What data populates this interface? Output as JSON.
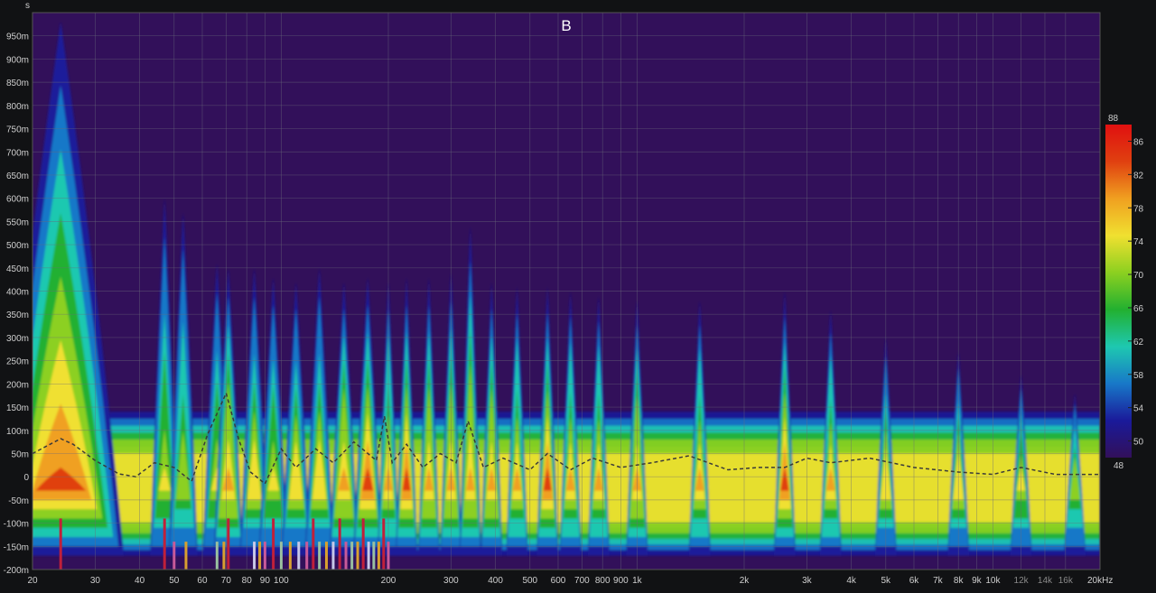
{
  "chart_data": {
    "type": "heatmap",
    "title": "B",
    "y_unit_label": "s",
    "x_scale": "log",
    "xlim_hz": [
      20,
      20000
    ],
    "ylim_s": [
      -0.2,
      1.0
    ],
    "x_ticks": [
      {
        "hz": 20,
        "label": "20"
      },
      {
        "hz": 30,
        "label": "30"
      },
      {
        "hz": 40,
        "label": "40"
      },
      {
        "hz": 50,
        "label": "50"
      },
      {
        "hz": 60,
        "label": "60"
      },
      {
        "hz": 70,
        "label": "70"
      },
      {
        "hz": 80,
        "label": "80"
      },
      {
        "hz": 90,
        "label": "90"
      },
      {
        "hz": 100,
        "label": "100"
      },
      {
        "hz": 200,
        "label": "200"
      },
      {
        "hz": 300,
        "label": "300"
      },
      {
        "hz": 400,
        "label": "400"
      },
      {
        "hz": 500,
        "label": "500"
      },
      {
        "hz": 600,
        "label": "600"
      },
      {
        "hz": 700,
        "label": "700"
      },
      {
        "hz": 800,
        "label": "800"
      },
      {
        "hz": 900,
        "label": "900"
      },
      {
        "hz": 1000,
        "label": "1k"
      },
      {
        "hz": 2000,
        "label": "2k"
      },
      {
        "hz": 3000,
        "label": "3k"
      },
      {
        "hz": 4000,
        "label": "4k"
      },
      {
        "hz": 5000,
        "label": "5k"
      },
      {
        "hz": 6000,
        "label": "6k"
      },
      {
        "hz": 7000,
        "label": "7k"
      },
      {
        "hz": 8000,
        "label": "8k"
      },
      {
        "hz": 9000,
        "label": "9k"
      },
      {
        "hz": 10000,
        "label": "10k"
      },
      {
        "hz": 12000,
        "label": "12k",
        "dim": true
      },
      {
        "hz": 14000,
        "label": "14k",
        "dim": true
      },
      {
        "hz": 16000,
        "label": "16k",
        "dim": true
      },
      {
        "hz": 20000,
        "label": "20kHz"
      }
    ],
    "y_ticks": [
      {
        "v": 0.95,
        "label": "950m"
      },
      {
        "v": 0.9,
        "label": "900m"
      },
      {
        "v": 0.85,
        "label": "850m"
      },
      {
        "v": 0.8,
        "label": "800m"
      },
      {
        "v": 0.75,
        "label": "750m"
      },
      {
        "v": 0.7,
        "label": "700m"
      },
      {
        "v": 0.65,
        "label": "650m"
      },
      {
        "v": 0.6,
        "label": "600m"
      },
      {
        "v": 0.55,
        "label": "550m"
      },
      {
        "v": 0.5,
        "label": "500m"
      },
      {
        "v": 0.45,
        "label": "450m"
      },
      {
        "v": 0.4,
        "label": "400m"
      },
      {
        "v": 0.35,
        "label": "350m"
      },
      {
        "v": 0.3,
        "label": "300m"
      },
      {
        "v": 0.25,
        "label": "250m"
      },
      {
        "v": 0.2,
        "label": "200m"
      },
      {
        "v": 0.15,
        "label": "150m"
      },
      {
        "v": 0.1,
        "label": "100m"
      },
      {
        "v": 0.05,
        "label": "50m"
      },
      {
        "v": 0.0,
        "label": "0"
      },
      {
        "v": -0.05,
        "label": "-50m"
      },
      {
        "v": -0.1,
        "label": "-100m"
      },
      {
        "v": -0.15,
        "label": "-150m"
      },
      {
        "v": -0.2,
        "label": "-200m"
      }
    ],
    "colorbar": {
      "min": 48,
      "max": 88,
      "top_label": "88",
      "bottom_label": "48",
      "ticks": [
        86,
        82,
        78,
        74,
        70,
        66,
        62,
        58,
        54,
        50
      ]
    },
    "resonances": [
      {
        "hz": 24,
        "decay_s": 0.98,
        "level": 82
      },
      {
        "hz": 47,
        "decay_s": 0.6,
        "level": 74
      },
      {
        "hz": 53,
        "decay_s": 0.57,
        "level": 72
      },
      {
        "hz": 66,
        "decay_s": 0.46,
        "level": 74
      },
      {
        "hz": 71,
        "decay_s": 0.45,
        "level": 80
      },
      {
        "hz": 84,
        "decay_s": 0.45,
        "level": 76
      },
      {
        "hz": 95,
        "decay_s": 0.43,
        "level": 74
      },
      {
        "hz": 110,
        "decay_s": 0.42,
        "level": 76
      },
      {
        "hz": 128,
        "decay_s": 0.45,
        "level": 76
      },
      {
        "hz": 150,
        "decay_s": 0.42,
        "level": 80
      },
      {
        "hz": 175,
        "decay_s": 0.43,
        "level": 82
      },
      {
        "hz": 200,
        "decay_s": 0.42,
        "level": 78
      },
      {
        "hz": 225,
        "decay_s": 0.43,
        "level": 84
      },
      {
        "hz": 260,
        "decay_s": 0.43,
        "level": 80
      },
      {
        "hz": 300,
        "decay_s": 0.44,
        "level": 80
      },
      {
        "hz": 340,
        "decay_s": 0.54,
        "level": 80
      },
      {
        "hz": 390,
        "decay_s": 0.42,
        "level": 80
      },
      {
        "hz": 460,
        "decay_s": 0.41,
        "level": 78
      },
      {
        "hz": 560,
        "decay_s": 0.41,
        "level": 82
      },
      {
        "hz": 650,
        "decay_s": 0.4,
        "level": 78
      },
      {
        "hz": 780,
        "decay_s": 0.39,
        "level": 78
      },
      {
        "hz": 1000,
        "decay_s": 0.38,
        "level": 80
      },
      {
        "hz": 1500,
        "decay_s": 0.38,
        "level": 78
      },
      {
        "hz": 2600,
        "decay_s": 0.4,
        "level": 82
      },
      {
        "hz": 3500,
        "decay_s": 0.36,
        "level": 78
      },
      {
        "hz": 5000,
        "decay_s": 0.3,
        "level": 76
      },
      {
        "hz": 8000,
        "decay_s": 0.27,
        "level": 76
      },
      {
        "hz": 12000,
        "decay_s": 0.22,
        "level": 74
      },
      {
        "hz": 17000,
        "decay_s": 0.18,
        "level": 72
      }
    ],
    "dashed_curve": [
      {
        "hz": 20,
        "s": 0.05
      },
      {
        "hz": 24,
        "s": 0.082
      },
      {
        "hz": 26,
        "s": 0.07
      },
      {
        "hz": 30,
        "s": 0.035
      },
      {
        "hz": 35,
        "s": 0.006
      },
      {
        "hz": 39,
        "s": 0.0
      },
      {
        "hz": 44,
        "s": 0.03
      },
      {
        "hz": 50,
        "s": 0.02
      },
      {
        "hz": 56,
        "s": -0.01
      },
      {
        "hz": 62,
        "s": 0.09
      },
      {
        "hz": 70,
        "s": 0.18
      },
      {
        "hz": 76,
        "s": 0.08
      },
      {
        "hz": 82,
        "s": 0.01
      },
      {
        "hz": 90,
        "s": -0.015
      },
      {
        "hz": 100,
        "s": 0.06
      },
      {
        "hz": 110,
        "s": 0.02
      },
      {
        "hz": 125,
        "s": 0.06
      },
      {
        "hz": 140,
        "s": 0.03
      },
      {
        "hz": 160,
        "s": 0.075
      },
      {
        "hz": 185,
        "s": 0.035
      },
      {
        "hz": 195,
        "s": 0.13
      },
      {
        "hz": 205,
        "s": 0.03
      },
      {
        "hz": 225,
        "s": 0.07
      },
      {
        "hz": 250,
        "s": 0.02
      },
      {
        "hz": 280,
        "s": 0.05
      },
      {
        "hz": 310,
        "s": 0.03
      },
      {
        "hz": 335,
        "s": 0.12
      },
      {
        "hz": 370,
        "s": 0.02
      },
      {
        "hz": 420,
        "s": 0.04
      },
      {
        "hz": 500,
        "s": 0.015
      },
      {
        "hz": 560,
        "s": 0.05
      },
      {
        "hz": 650,
        "s": 0.015
      },
      {
        "hz": 750,
        "s": 0.04
      },
      {
        "hz": 900,
        "s": 0.02
      },
      {
        "hz": 1100,
        "s": 0.03
      },
      {
        "hz": 1400,
        "s": 0.045
      },
      {
        "hz": 1800,
        "s": 0.015
      },
      {
        "hz": 2200,
        "s": 0.02
      },
      {
        "hz": 2600,
        "s": 0.02
      },
      {
        "hz": 3000,
        "s": 0.04
      },
      {
        "hz": 3500,
        "s": 0.03
      },
      {
        "hz": 4500,
        "s": 0.04
      },
      {
        "hz": 6000,
        "s": 0.02
      },
      {
        "hz": 8000,
        "s": 0.01
      },
      {
        "hz": 10000,
        "s": 0.005
      },
      {
        "hz": 12000,
        "s": 0.02
      },
      {
        "hz": 15000,
        "s": 0.005
      },
      {
        "hz": 20000,
        "s": 0.005
      }
    ],
    "bottom_markers": [
      {
        "hz": 24,
        "s": -0.09,
        "color": "#c0203a"
      },
      {
        "hz": 47,
        "s": -0.09,
        "color": "#c0203a"
      },
      {
        "hz": 50,
        "s": -0.14,
        "color": "#c85a9a"
      },
      {
        "hz": 54,
        "s": -0.14,
        "color": "#d8a030"
      },
      {
        "hz": 66,
        "s": -0.14,
        "color": "#9ac0a0"
      },
      {
        "hz": 69,
        "s": -0.14,
        "color": "#d8a030"
      },
      {
        "hz": 71,
        "s": -0.09,
        "color": "#c0203a"
      },
      {
        "hz": 84,
        "s": -0.14,
        "color": "#c8c8e8"
      },
      {
        "hz": 87,
        "s": -0.14,
        "color": "#d8a030"
      },
      {
        "hz": 90,
        "s": -0.14,
        "color": "#c85a9a"
      },
      {
        "hz": 95,
        "s": -0.09,
        "color": "#c0203a"
      },
      {
        "hz": 100,
        "s": -0.14,
        "color": "#9ac0a0"
      },
      {
        "hz": 106,
        "s": -0.14,
        "color": "#d8a030"
      },
      {
        "hz": 112,
        "s": -0.14,
        "color": "#c8c8e8"
      },
      {
        "hz": 118,
        "s": -0.14,
        "color": "#c85a9a"
      },
      {
        "hz": 123,
        "s": -0.09,
        "color": "#c0203a"
      },
      {
        "hz": 128,
        "s": -0.14,
        "color": "#9ac0a0"
      },
      {
        "hz": 134,
        "s": -0.14,
        "color": "#d8a030"
      },
      {
        "hz": 140,
        "s": -0.14,
        "color": "#c8c8e8"
      },
      {
        "hz": 146,
        "s": -0.09,
        "color": "#c0203a"
      },
      {
        "hz": 152,
        "s": -0.14,
        "color": "#c85a9a"
      },
      {
        "hz": 158,
        "s": -0.14,
        "color": "#9ac0a0"
      },
      {
        "hz": 164,
        "s": -0.14,
        "color": "#d8a030"
      },
      {
        "hz": 170,
        "s": -0.09,
        "color": "#c0203a"
      },
      {
        "hz": 176,
        "s": -0.14,
        "color": "#c8c8e8"
      },
      {
        "hz": 182,
        "s": -0.14,
        "color": "#9ac0a0"
      },
      {
        "hz": 188,
        "s": -0.14,
        "color": "#d8a030"
      },
      {
        "hz": 194,
        "s": -0.09,
        "color": "#c0203a"
      },
      {
        "hz": 200,
        "s": -0.14,
        "color": "#c85a9a"
      }
    ],
    "colors": {
      "background": "#111214",
      "plot_floor": "#32105a",
      "grid": "#6a6a7a",
      "axis_text": "#cfcfcf",
      "curve": "#3a3a3a"
    },
    "colormap": [
      "#32105a",
      "#1a1a9a",
      "#1878c8",
      "#1ec8b0",
      "#22b030",
      "#8cd020",
      "#f0e030",
      "#f0a020",
      "#e04010",
      "#e01010"
    ]
  }
}
